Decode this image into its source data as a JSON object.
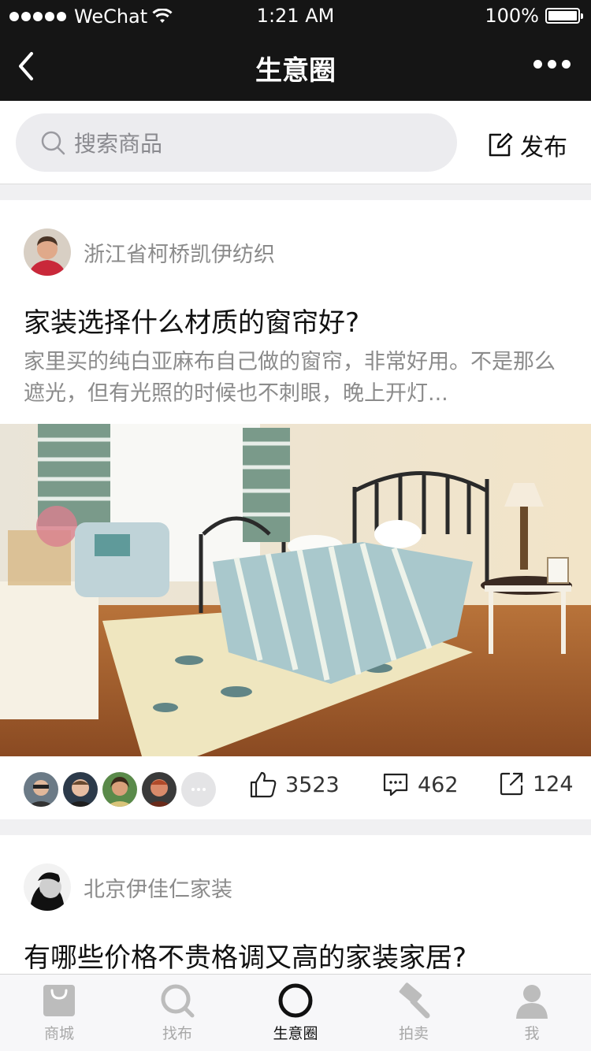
{
  "status_bar": {
    "carrier": "WeChat",
    "time": "1:21 AM",
    "battery": "100%"
  },
  "nav": {
    "title": "生意圈"
  },
  "search": {
    "placeholder": "搜索商品",
    "publish_label": "发布"
  },
  "posts": [
    {
      "author": "浙江省柯桥凯伊纺织",
      "title": "家装选择什么材质的窗帘好?",
      "excerpt": "家里买的纯白亚麻布自己做的窗帘，非常好用。不是那么遮光，但有光照的时候也不刺眼，晚上开灯...",
      "likes": "3523",
      "comments": "462",
      "shares": "124"
    },
    {
      "author": "北京伊佳仁家装",
      "title": "有哪些价格不贵格调又高的家装家居?"
    }
  ],
  "tabs": [
    {
      "label": "商城",
      "icon": "bag-icon"
    },
    {
      "label": "找布",
      "icon": "search-icon"
    },
    {
      "label": "生意圈",
      "icon": "circle-icon"
    },
    {
      "label": "拍卖",
      "icon": "gavel-icon"
    },
    {
      "label": "我",
      "icon": "person-icon"
    }
  ],
  "colors": {
    "header": "#151515",
    "page_bg": "#f0f0f2",
    "muted_text": "#8b8b8b",
    "tab_inactive": "#a8a8a8"
  }
}
